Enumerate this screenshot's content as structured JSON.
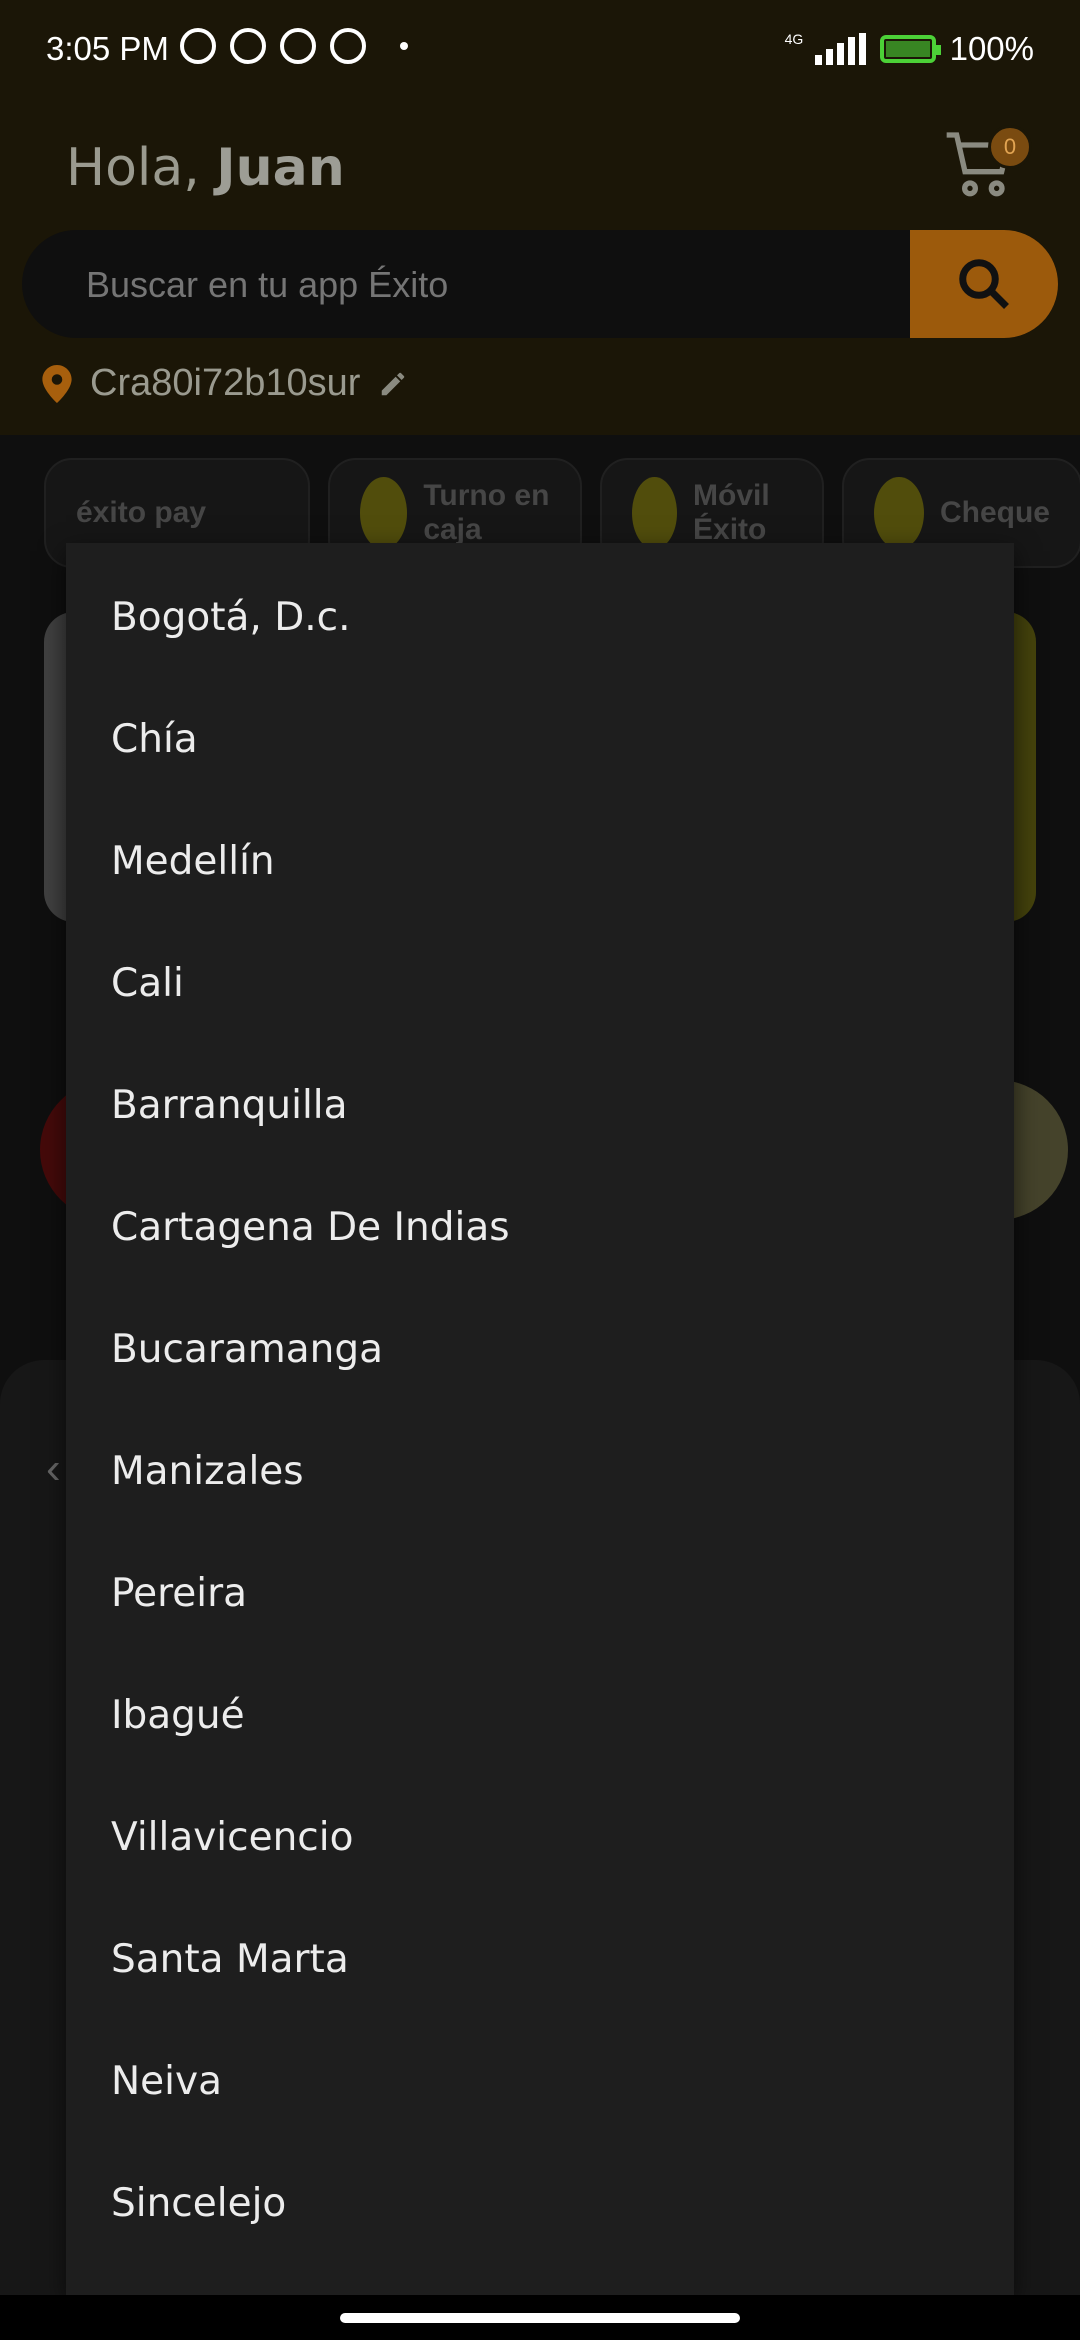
{
  "status": {
    "time": "3:05 PM",
    "network": "4G",
    "battery": "100%"
  },
  "header": {
    "greeting": "Hola,",
    "user": "Juan",
    "cart_count": "0",
    "search_placeholder": "Buscar en tu app Éxito",
    "location": "Cra80i72b10sur"
  },
  "quick_actions": {
    "pay": "éxito pay",
    "turno": "Turno en caja",
    "movil": "Móvil Éxito",
    "cheque": "Cheque"
  },
  "dropdown": {
    "cities": [
      "Bogotá, D.c.",
      "Chía",
      "Medellín",
      "Cali",
      "Barranquilla",
      "Cartagena De Indias",
      "Bucaramanga",
      "Manizales",
      "Pereira",
      "Ibagué",
      "Villavicencio",
      "Santa Marta",
      "Neiva",
      "Sincelejo"
    ]
  }
}
